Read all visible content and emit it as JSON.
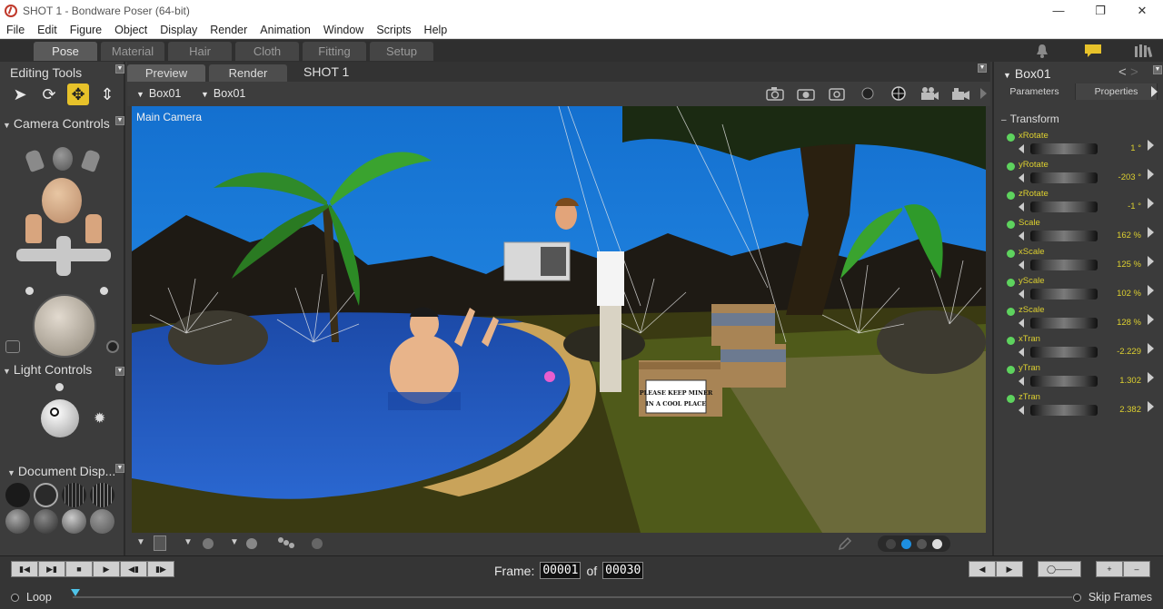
{
  "window": {
    "title": "SHOT 1 - Bondware Poser (64-bit)"
  },
  "menu": [
    "File",
    "Edit",
    "Figure",
    "Object",
    "Display",
    "Render",
    "Animation",
    "Window",
    "Scripts",
    "Help"
  ],
  "room_tabs": [
    "Pose",
    "Material",
    "Hair",
    "Cloth",
    "Fitting",
    "Setup"
  ],
  "left_panel": {
    "editing_tools": "Editing Tools",
    "camera_controls": "Camera Controls",
    "light_controls": "Light Controls",
    "document_display": "Document  Disp..."
  },
  "view_tabs": [
    "Preview",
    "Render"
  ],
  "shot_label": "SHOT 1",
  "view_toolbar": {
    "figure_select": "Box01",
    "actor_select": "Box01"
  },
  "viewport": {
    "camera_label": "Main Camera",
    "sign_line1": "PLEASE KEEP MINER",
    "sign_line2": "IN A COOL PLACE"
  },
  "right_panel": {
    "title": "Box01",
    "tabs": [
      "Parameters",
      "Properties"
    ],
    "group": "Transform",
    "params": [
      {
        "name": "xRotate",
        "value": "1 °"
      },
      {
        "name": "yRotate",
        "value": "-203 °"
      },
      {
        "name": "zRotate",
        "value": "-1 °"
      },
      {
        "name": "Scale",
        "value": "162 %"
      },
      {
        "name": "xScale",
        "value": "125 %"
      },
      {
        "name": "yScale",
        "value": "102 %"
      },
      {
        "name": "zScale",
        "value": "128 %"
      },
      {
        "name": "xTran",
        "value": "-2.229"
      },
      {
        "name": "yTran",
        "value": "1.302"
      },
      {
        "name": "zTran",
        "value": "2.382"
      }
    ]
  },
  "timeline": {
    "frame_label": "Frame:",
    "current_frame": "00001",
    "of_label": "of",
    "total_frames": "00030",
    "loop_label": "Loop",
    "skip_frames_label": "Skip Frames"
  },
  "colors": {
    "accent_yellow": "#e7c22a",
    "param_text": "#ddd030",
    "param_dot": "#5ed35e",
    "sky": "#1e7ad6"
  }
}
